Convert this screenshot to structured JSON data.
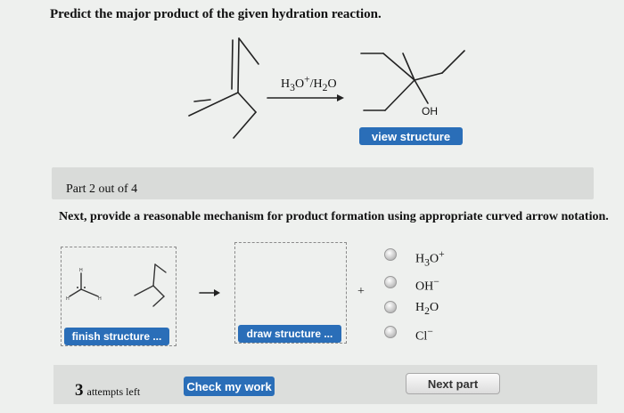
{
  "question": {
    "title": "Predict the major product of the given hydration reaction."
  },
  "reaction": {
    "reagent_html": "H<sub>3</sub>O<sup>+</sup>/H<sub>2</sub>O",
    "product_oh_label": "OH"
  },
  "buttons": {
    "view_structure": "view structure",
    "finish_structure": "finish structure ...",
    "draw_structure": "draw structure ...",
    "check_my_work": "Check my work",
    "next_part": "Next part"
  },
  "part": {
    "label": "Part 2 out of 4"
  },
  "instruction": "Next, provide a reasonable mechanism for product formation using appropriate curved arrow notation.",
  "mechanism": {
    "plus_sign": "+",
    "options_html": [
      "H<sub>3</sub>O<sup>+</sup>",
      "OH<sup>&minus;</sup>",
      "H<sub>2</sub>O",
      "Cl<sup>&minus;</sup>"
    ]
  },
  "attempts": {
    "count": "3",
    "label": "attempts left"
  },
  "colors": {
    "primary_button": "#2a6eb8",
    "background": "#eef0ee"
  }
}
